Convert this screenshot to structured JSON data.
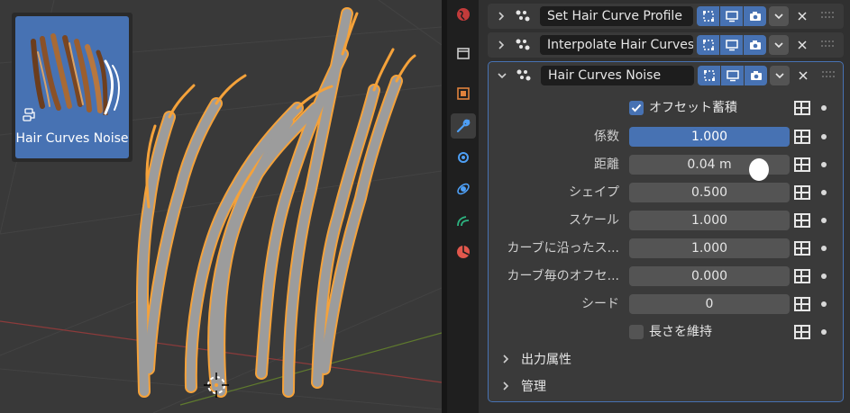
{
  "viewport": {
    "thumbnail_label": "Hair Curves Noise"
  },
  "tabs": [
    {
      "name": "world-icon",
      "color": "#c23b3b"
    },
    {
      "name": "collection-icon",
      "color": "#cccccc"
    },
    {
      "name": "object-icon",
      "color": "#e0823c"
    },
    {
      "name": "modifier-icon",
      "color": "#4e9ff5"
    },
    {
      "name": "particles-icon",
      "color": "#4e9ff5"
    },
    {
      "name": "physics-icon",
      "color": "#4e9ff5"
    },
    {
      "name": "constraints-icon",
      "color": "#2db380"
    },
    {
      "name": "data-icon",
      "color": "#e2574c"
    }
  ],
  "modifiers": [
    {
      "name": "Set Hair Curve Profile",
      "expanded": false
    },
    {
      "name": "Interpolate Hair Curves",
      "expanded": false
    },
    {
      "name": "Hair Curves Noise",
      "expanded": true
    }
  ],
  "panel": {
    "offset_accumulate": {
      "label": "オフセット蓄積",
      "checked": true
    },
    "fields": [
      {
        "label": "係数",
        "value": "1.000",
        "active": true
      },
      {
        "label": "距離",
        "value": "0.04 m",
        "active": false
      },
      {
        "label": "シェイプ",
        "value": "0.500",
        "active": false
      },
      {
        "label": "スケール",
        "value": "1.000",
        "active": false
      },
      {
        "label": "カーブに沿ったス...",
        "value": "1.000",
        "active": false
      },
      {
        "label": "カーブ毎のオフセ...",
        "value": "0.000",
        "active": false
      },
      {
        "label": "シード",
        "value": "0",
        "active": false
      }
    ],
    "preserve_length": {
      "label": "長さを維持",
      "checked": false
    },
    "subpanels": [
      {
        "label": "出力属性"
      },
      {
        "label": "管理"
      }
    ]
  },
  "colors": {
    "accent": "#4772b3",
    "selection_orange": "#f5a23a",
    "hair_gray": "#9c9c9c"
  }
}
